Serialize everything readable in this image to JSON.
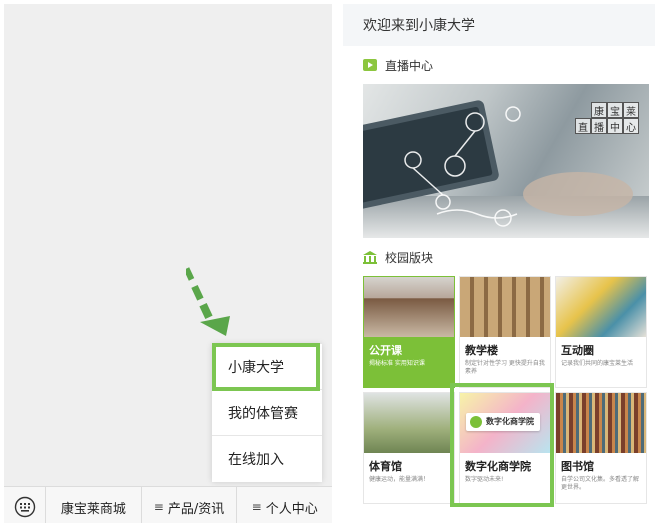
{
  "left_panel": {
    "menu": {
      "items": [
        "小康大学",
        "我的体管赛",
        "在线加入"
      ]
    },
    "tabbar": {
      "tabs": [
        {
          "label": "康宝莱商城",
          "prefix": ""
        },
        {
          "label": "产品/资讯",
          "prefix": "≡"
        },
        {
          "label": "个人中心",
          "prefix": "≡"
        }
      ]
    }
  },
  "right_panel": {
    "welcome": "欢迎来到小康大学",
    "live_section": "直播中心",
    "banner_text": [
      "康",
      "宝",
      "莱",
      "直",
      "播",
      "中",
      "心"
    ],
    "campus_section": "校园版块",
    "cards": [
      {
        "title": "公开课",
        "desc": "揭秘标准 实用知识课"
      },
      {
        "title": "教学楼",
        "desc": "制定针对性学习 更快提升自我素养"
      },
      {
        "title": "互动圈",
        "desc": "记录我们共同的康宝莱生活"
      },
      {
        "title": "体育馆",
        "desc": "健康运动，能量满满！"
      },
      {
        "title": "数字化商学院",
        "desc": "数字驱动未来!",
        "badge": "数字化商学院"
      },
      {
        "title": "图书馆",
        "desc": "自学公司文化集。多看透了解更世界。"
      }
    ]
  },
  "colors": {
    "highlight": "#7cc651",
    "accent_green": "#7cc038"
  }
}
